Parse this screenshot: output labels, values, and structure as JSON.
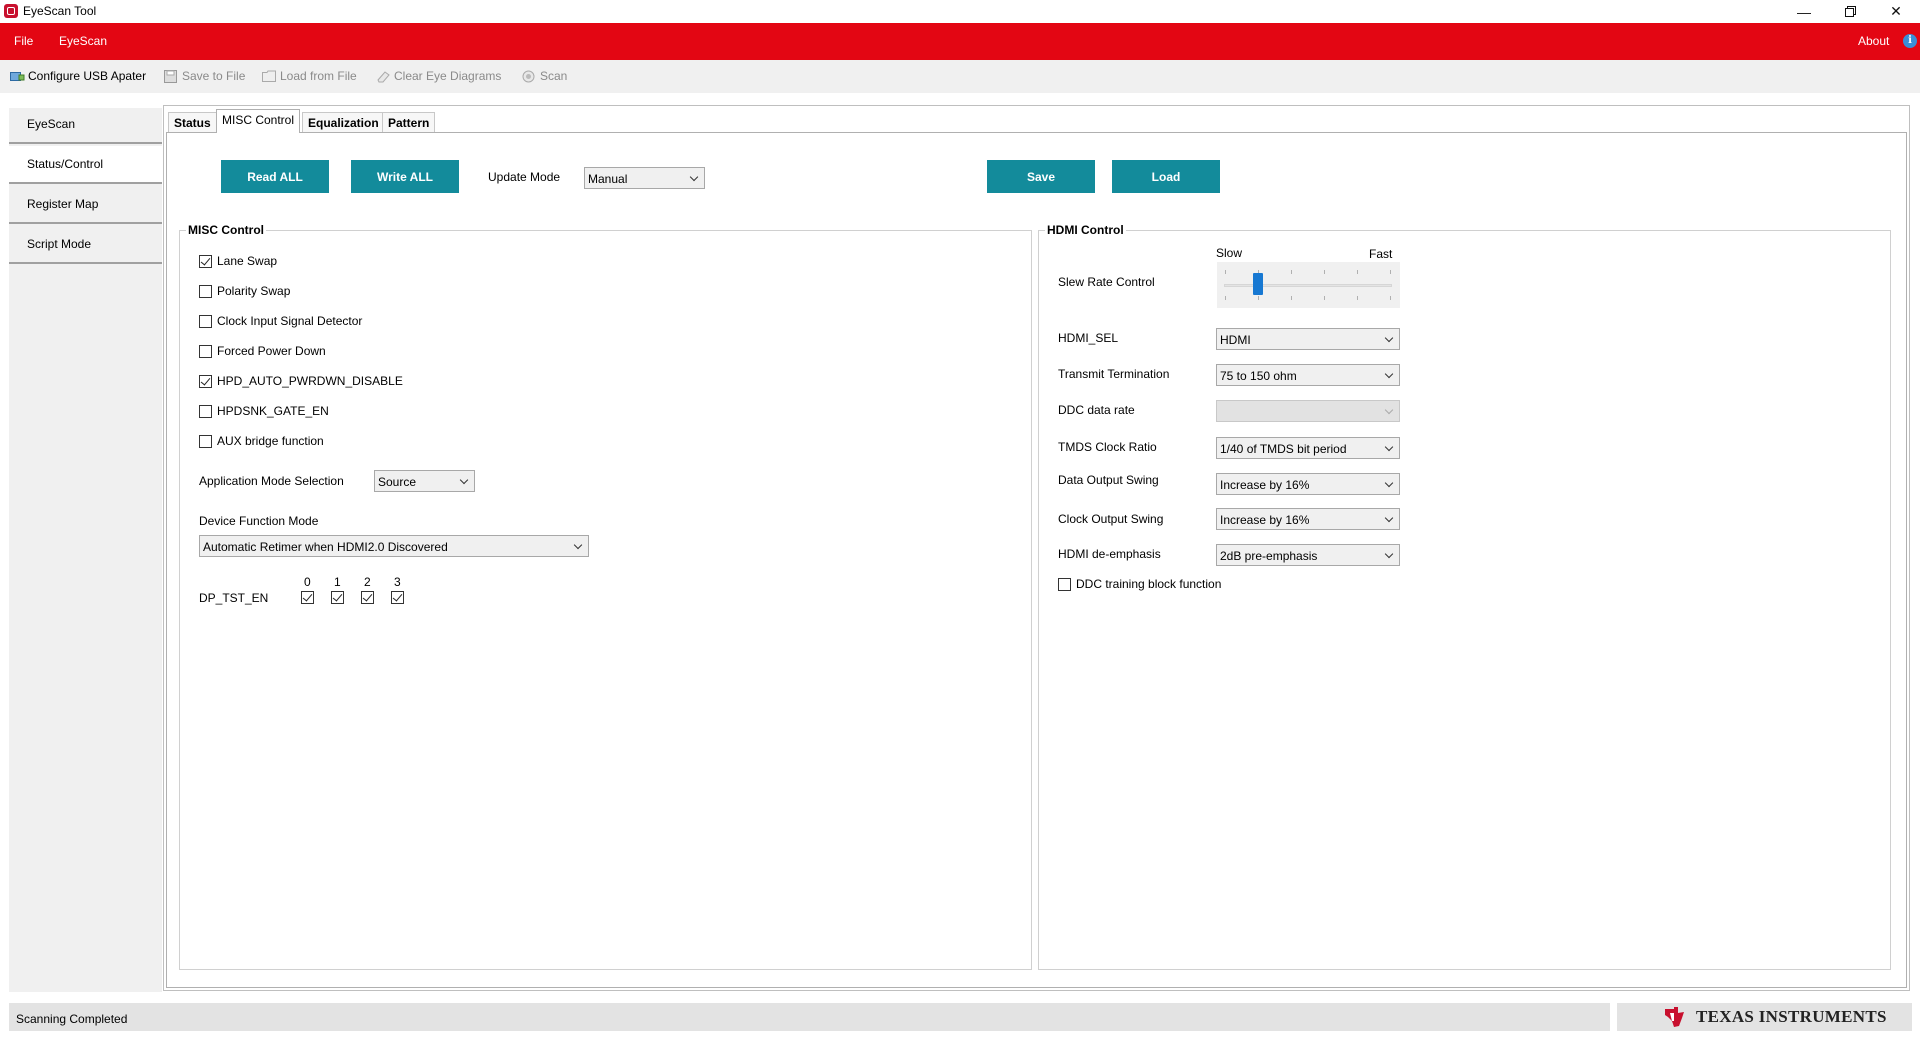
{
  "window": {
    "title": "EyeScan Tool"
  },
  "menu": {
    "file": "File",
    "eyescan": "EyeScan",
    "about": "About"
  },
  "toolbar": {
    "configure": "Configure USB Apater",
    "save": "Save to File",
    "load": "Load from File",
    "clear": "Clear Eye Diagrams",
    "scan": "Scan"
  },
  "nav": [
    "EyeScan",
    "Status/Control",
    "Register Map",
    "Script Mode"
  ],
  "tabs": [
    "Status",
    "MISC Control",
    "Equalization",
    "Pattern"
  ],
  "actions": {
    "read_all": "Read ALL",
    "write_all": "Write ALL",
    "update_mode_label": "Update Mode",
    "update_mode_value": "Manual",
    "save": "Save",
    "load": "Load"
  },
  "misc": {
    "title": "MISC Control",
    "checkboxes": [
      {
        "label": "Lane Swap",
        "checked": true
      },
      {
        "label": "Polarity Swap",
        "checked": false
      },
      {
        "label": "Clock Input Signal Detector",
        "checked": false
      },
      {
        "label": "Forced Power Down",
        "checked": false
      },
      {
        "label": "HPD_AUTO_PWRDWN_DISABLE",
        "checked": true
      },
      {
        "label": "HPDSNK_GATE_EN",
        "checked": false
      },
      {
        "label": "AUX bridge function",
        "checked": false
      }
    ],
    "app_mode_label": "Application Mode Selection",
    "app_mode_value": "Source",
    "device_mode_label": "Device Function Mode",
    "device_mode_value": "Automatic Retimer when HDMI2.0 Discovered",
    "dp_tst_label": "DP_TST_EN",
    "dp_tst_lanes": [
      "0",
      "1",
      "2",
      "3"
    ],
    "dp_tst_checked": [
      true,
      true,
      true,
      true
    ]
  },
  "hdmi": {
    "title": "HDMI Control",
    "slew": {
      "label": "Slew Rate Control",
      "min_label": "Slow",
      "max_label": "Fast",
      "value": 1,
      "max": 5
    },
    "fields": [
      {
        "label": "HDMI_SEL",
        "value": "HDMI",
        "enabled": true
      },
      {
        "label": "Transmit Termination",
        "value": "75 to 150 ohm",
        "enabled": true
      },
      {
        "label": "DDC data rate",
        "value": "",
        "enabled": false
      },
      {
        "label": "TMDS Clock Ratio",
        "value": "1/40 of TMDS bit period",
        "enabled": true
      },
      {
        "label": "Data Output Swing",
        "value": "Increase by 16%",
        "enabled": true
      },
      {
        "label": "Clock Output Swing",
        "value": "Increase by 16%",
        "enabled": true
      },
      {
        "label": "HDMI de-emphasis",
        "value": "2dB pre-emphasis",
        "enabled": true
      }
    ],
    "ddc_training": {
      "label": "DDC training block function",
      "checked": false
    }
  },
  "status": {
    "text": "Scanning Completed"
  },
  "brand": {
    "name": "Texas Instruments",
    "display": "TEXAS INSTRUMENTS"
  },
  "colors": {
    "menubar": "#e30613",
    "button": "#138b9b",
    "slider_thumb": "#1778d2"
  }
}
